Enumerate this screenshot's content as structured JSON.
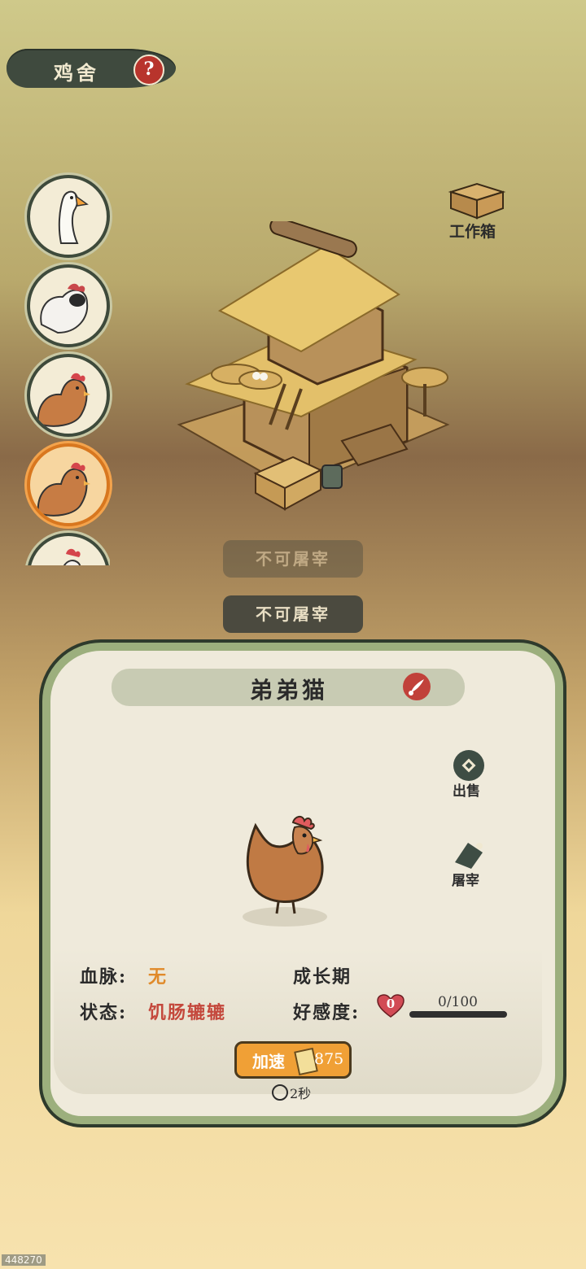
{
  "header": {
    "title": "鸡舍",
    "help_symbol": "?"
  },
  "animal_list": [
    {
      "name": "goose",
      "selected": false
    },
    {
      "name": "silkie",
      "selected": false
    },
    {
      "name": "hen",
      "selected": false
    },
    {
      "name": "hen",
      "selected": true
    },
    {
      "name": "rooster",
      "selected": false
    }
  ],
  "building": {
    "workbox_label": "工作箱"
  },
  "buttons": {
    "slaughter_disabled_1": "不可屠宰",
    "slaughter_disabled_2": "不可屠宰"
  },
  "detail": {
    "name": "弟弟猫",
    "actions": {
      "sell": "出售",
      "slaughter": "屠宰"
    },
    "stats": {
      "bloodline_label": "血脉:",
      "bloodline_value": "无",
      "stage": "成长期",
      "status_label": "状态:",
      "status_value": "饥肠辘辘",
      "favor_label": "好感度:",
      "favor_level": "0",
      "favor_progress": "0/100",
      "favor_fraction": 0
    },
    "speedup": {
      "label": "加速",
      "cost": "875",
      "time": "2秒"
    }
  },
  "footer": {
    "id": "448270"
  },
  "colors": {
    "accent_orange": "#f0a036",
    "card_border": "#9caf7d",
    "status_red": "#c4483c",
    "bloodline_orange": "#e08a2a"
  }
}
